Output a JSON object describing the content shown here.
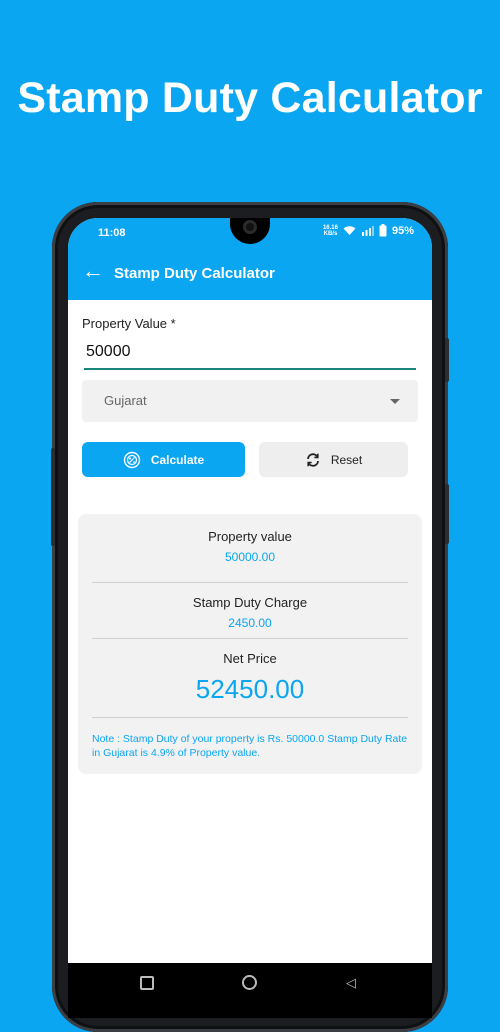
{
  "promo": {
    "title": "Stamp Duty Calculator"
  },
  "status_bar": {
    "time": "11:08",
    "net_speed_value": "16.16",
    "net_speed_unit": "KB/s",
    "battery": "95%"
  },
  "app_bar": {
    "title": "Stamp Duty Calculator"
  },
  "form": {
    "property_label": "Property Value *",
    "property_value": "50000",
    "state_selected": "Gujarat",
    "calculate_label": "Calculate",
    "reset_label": "Reset"
  },
  "result": {
    "property_label": "Property value",
    "property_value": "50000.00",
    "stamp_label": "Stamp Duty Charge",
    "stamp_value": "2450.00",
    "net_label": "Net Price",
    "net_value": "52450.00",
    "note": "Note : Stamp Duty of your property is Rs. 50000.0 Stamp Duty Rate in Gujarat is 4.9% of Property value."
  },
  "colors": {
    "accent": "#0aa6f2",
    "input_underline": "#18857a",
    "card_bg": "#f2f2f2"
  },
  "icons": [
    "back-arrow-icon",
    "wifi-icon",
    "signal-icon",
    "battery-icon",
    "calculator-icon",
    "refresh-icon",
    "nav-recents-icon",
    "nav-home-icon",
    "nav-back-icon"
  ]
}
